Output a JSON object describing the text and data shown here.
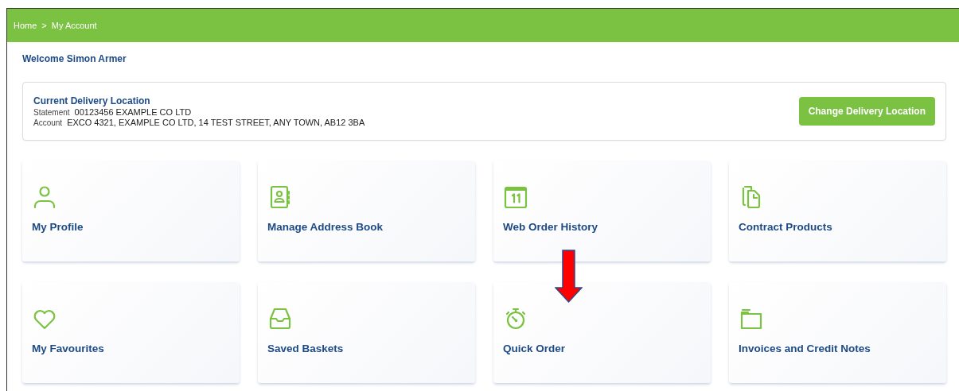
{
  "breadcrumb": [
    {
      "label": "Home"
    },
    {
      "label": "My Account"
    }
  ],
  "breadcrumb_separator": ">",
  "welcome": "Welcome Simon Armer",
  "delivery": {
    "title": "Current Delivery Location",
    "fields": [
      {
        "label": "Statement",
        "value": "00123456 EXAMPLE CO LTD"
      },
      {
        "label": "Account",
        "value": "EXCO 4321, EXAMPLE CO LTD, 14 TEST STREET, ANY TOWN, AB12 3BA"
      }
    ],
    "button": "Change Delivery Location"
  },
  "tiles": [
    {
      "label": "My Profile",
      "kind": "person"
    },
    {
      "label": "Manage Address Book",
      "kind": "addressbook"
    },
    {
      "label": "Web Order History",
      "kind": "calendar"
    },
    {
      "label": "Contract Products",
      "kind": "documents"
    },
    {
      "label": "My Favourites",
      "kind": "heart"
    },
    {
      "label": "Saved Baskets",
      "kind": "tray"
    },
    {
      "label": "Quick Order",
      "kind": "stopwatch"
    },
    {
      "label": "Invoices and Credit Notes",
      "kind": "folder"
    }
  ],
  "annotations": [
    {
      "kind": "arrow"
    }
  ]
}
